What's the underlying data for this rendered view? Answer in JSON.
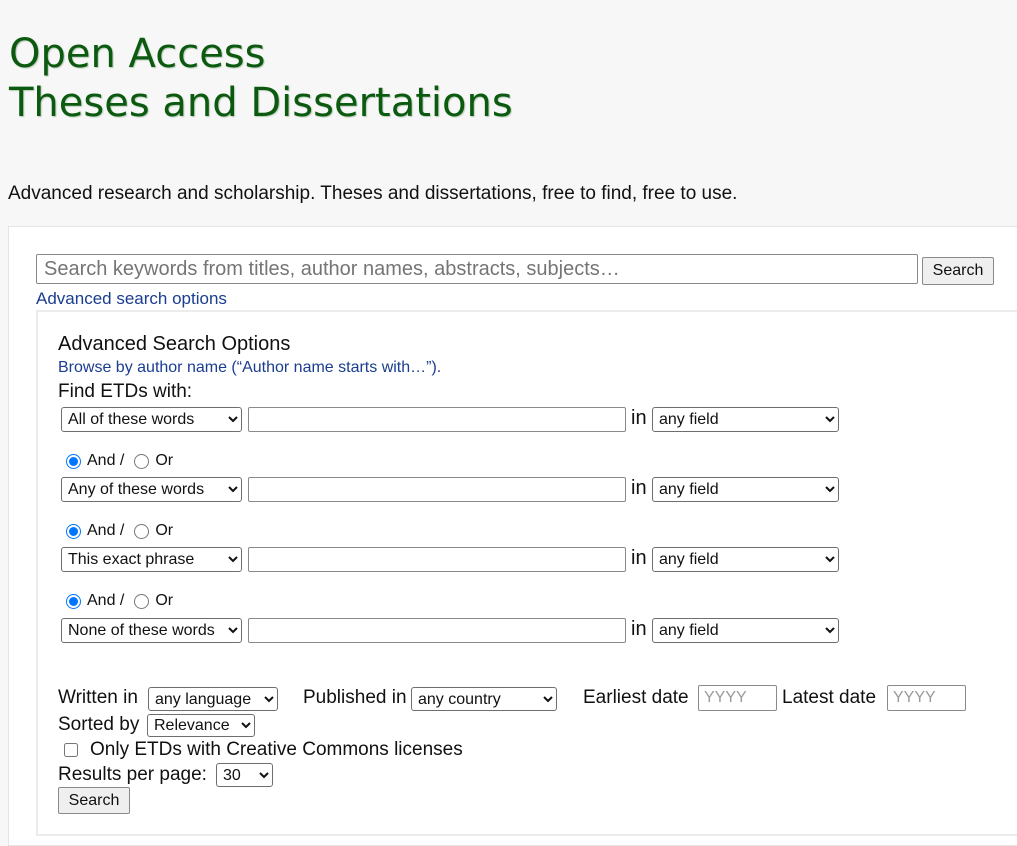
{
  "header": {
    "title_line1": "Open Access",
    "title_line2": "Theses and Dissertations",
    "tagline": "Advanced research and scholarship. Theses and dissertations, free to find, free to use."
  },
  "search": {
    "placeholder": "Search keywords from titles, author names, abstracts, subjects…",
    "value": "",
    "button_label": "Search",
    "advanced_link": "Advanced search options"
  },
  "advanced": {
    "heading": "Advanced Search Options",
    "browse_link": "Browse by author name (“Author name starts with…”).",
    "find_label": "Find ETDs with:",
    "in_label": "in",
    "rows": [
      {
        "match": "All of these words",
        "term": "",
        "field": "any field"
      },
      {
        "match": "Any of these words",
        "term": "",
        "field": "any field"
      },
      {
        "match": "This exact phrase",
        "term": "",
        "field": "any field"
      },
      {
        "match": "None of these words",
        "term": "",
        "field": "any field"
      }
    ],
    "boolean": {
      "and_label": "And /",
      "or_label": "Or",
      "selected": "And"
    },
    "written_in_label": "Written in",
    "language": "any language",
    "published_in_label": "Published in",
    "country": "any country",
    "earliest_label": "Earliest date",
    "earliest_placeholder": "YYYY",
    "latest_label": "Latest date",
    "latest_placeholder": "YYYY",
    "sorted_by_label": "Sorted by",
    "sort": "Relevance",
    "cc_label": "Only ETDs with Creative Commons licenses",
    "cc_checked": false,
    "results_label": "Results per page:",
    "results_per_page": "30",
    "search_button": "Search"
  },
  "colors": {
    "title": "#0b5a10",
    "link": "#1a3d8f",
    "page_bg": "#f7f7f7"
  }
}
